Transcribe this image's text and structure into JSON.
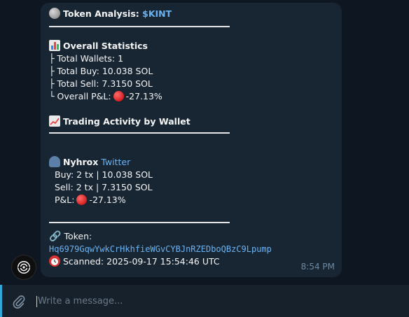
{
  "message": {
    "title_prefix": "Token Analysis: ",
    "title_ticker": "$KINT",
    "overall": {
      "heading": "Overall Statistics",
      "total_wallets": "├ Total Wallets: 1",
      "total_buy": "├ Total Buy: 10.038 SOL",
      "total_sell": "├ Total Sell: 7.3150 SOL",
      "pnl_label": "└ Overall P&L:",
      "pnl_value": "-27.13%"
    },
    "activity": {
      "heading": "Trading Activity by Wallet",
      "wallet_name": "Nyhrox",
      "wallet_link": "Twitter",
      "buy": "Buy: 2 tx | 10.038 SOL",
      "sell": "Sell: 2 tx | 7.3150 SOL",
      "pnl_label": "P&L:",
      "pnl_value": "-27.13%"
    },
    "token_label": "Token:",
    "token_address": "Hq6979GqwYwkCrHkhfieWGvCYBJnRZEDboQBzC9Lpump",
    "scanned": "Scanned: 2025-09-17 15:54:46 UTC",
    "time": "8:54 PM"
  },
  "composer": {
    "placeholder": "Write a message..."
  },
  "icons": {
    "moon": "new-moon-icon",
    "stats": "bar-chart-icon",
    "trend": "chart-increasing-icon",
    "user": "bust-in-silhouette-icon",
    "link": "link-icon",
    "clock": "alarm-clock-icon",
    "red": "red-circle-icon",
    "attach": "paperclip-icon"
  },
  "colors": {
    "background": "#0e1621",
    "bubble": "#182533",
    "link": "#6ab3f3",
    "accent": "#2fa7d8"
  }
}
